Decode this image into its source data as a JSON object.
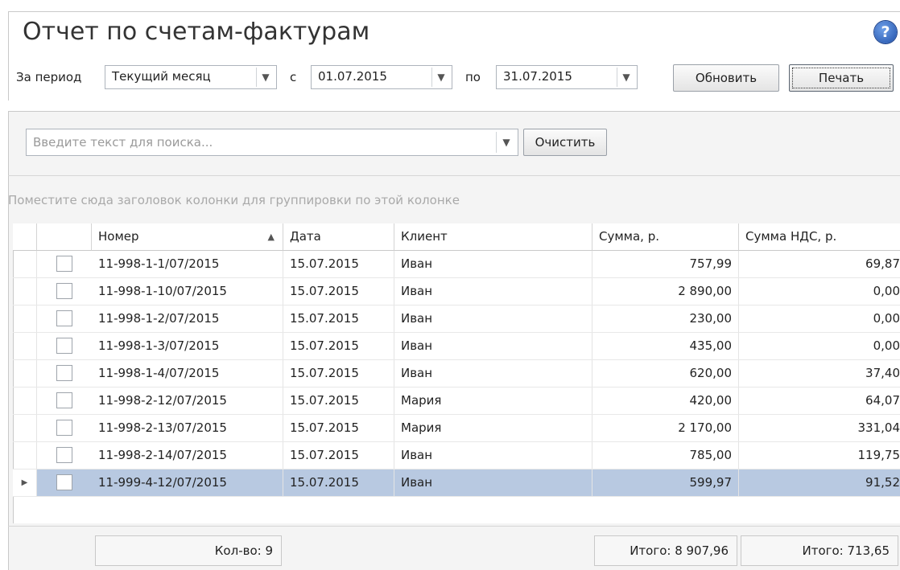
{
  "header": {
    "title": "Отчет по счетам-фактурам",
    "help_glyph": "?"
  },
  "filters": {
    "period_label": "За период",
    "period_value": "Текущий месяц",
    "from_label": "с",
    "from_value": "01.07.2015",
    "to_label": "по",
    "to_value": "31.07.2015",
    "refresh_label": "Обновить",
    "print_label": "Печать"
  },
  "search": {
    "placeholder": "Введите текст для поиска...",
    "clear_label": "Очистить"
  },
  "group_hint": "Поместите сюда заголовок колонки для группировки по этой колонке",
  "table": {
    "columns": [
      "Номер",
      "Дата",
      "Клиент",
      "Сумма, р.",
      "Сумма НДС, р."
    ],
    "sort_glyph": "▲",
    "rows": [
      [
        "11-998-1-1/07/2015",
        "15.07.2015",
        "Иван",
        "757,99",
        "69,87"
      ],
      [
        "11-998-1-10/07/2015",
        "15.07.2015",
        "Иван",
        "2 890,00",
        "0,00"
      ],
      [
        "11-998-1-2/07/2015",
        "15.07.2015",
        "Иван",
        "230,00",
        "0,00"
      ],
      [
        "11-998-1-3/07/2015",
        "15.07.2015",
        "Иван",
        "435,00",
        "0,00"
      ],
      [
        "11-998-1-4/07/2015",
        "15.07.2015",
        "Иван",
        "620,00",
        "37,40"
      ],
      [
        "11-998-2-12/07/2015",
        "15.07.2015",
        "Мария",
        "420,00",
        "64,07"
      ],
      [
        "11-998-2-13/07/2015",
        "15.07.2015",
        "Мария",
        "2 170,00",
        "331,04"
      ],
      [
        "11-998-2-14/07/2015",
        "15.07.2015",
        "Иван",
        "785,00",
        "119,75"
      ],
      [
        "11-999-4-12/07/2015",
        "15.07.2015",
        "Иван",
        "599,97",
        "91,52"
      ]
    ],
    "selected_index": 8
  },
  "footer": {
    "count": "Кол-во: 9",
    "sum_total": "Итого: 8 907,96",
    "vat_total": "Итого: 713,65"
  },
  "colors": {
    "selected_row": "#b8c9e1",
    "help_icon": "#2a5bb5"
  }
}
